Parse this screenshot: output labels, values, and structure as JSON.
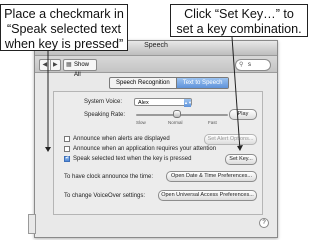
{
  "callouts": {
    "left_lines": [
      "Place a checkmark in",
      "“Speak selected text",
      "when key is pressed”"
    ],
    "right_lines": [
      "Click “Set Key…” to",
      "set a key combination."
    ]
  },
  "window": {
    "title": "Speech"
  },
  "toolbar": {
    "show_all": "Show All",
    "search_value": "s",
    "back": "◀",
    "forward": "▶"
  },
  "tabs": [
    {
      "label": "Speech Recognition",
      "active": false
    },
    {
      "label": "Text to Speech",
      "active": true
    }
  ],
  "voice": {
    "label": "System Voice:",
    "value": "Alex"
  },
  "rate": {
    "label": "Speaking Rate:",
    "ticks": [
      "Slow",
      "Normal",
      "Fast"
    ],
    "play": "Play"
  },
  "options": [
    {
      "label": "Announce when alerts are displayed",
      "checked": false
    },
    {
      "label": "Announce when an application requires your attention",
      "checked": false
    },
    {
      "label": "Speak selected text when the key is pressed",
      "checked": true
    }
  ],
  "buttons": {
    "set_alert": "Set Alert Options...",
    "set_key": "Set Key..."
  },
  "clock": {
    "label": "To have clock announce the time:",
    "button": "Open Date & Time Preferences..."
  },
  "voiceover": {
    "label": "To change VoiceOver settings:",
    "button": "Open Universal Access Preferences..."
  },
  "help": "?"
}
